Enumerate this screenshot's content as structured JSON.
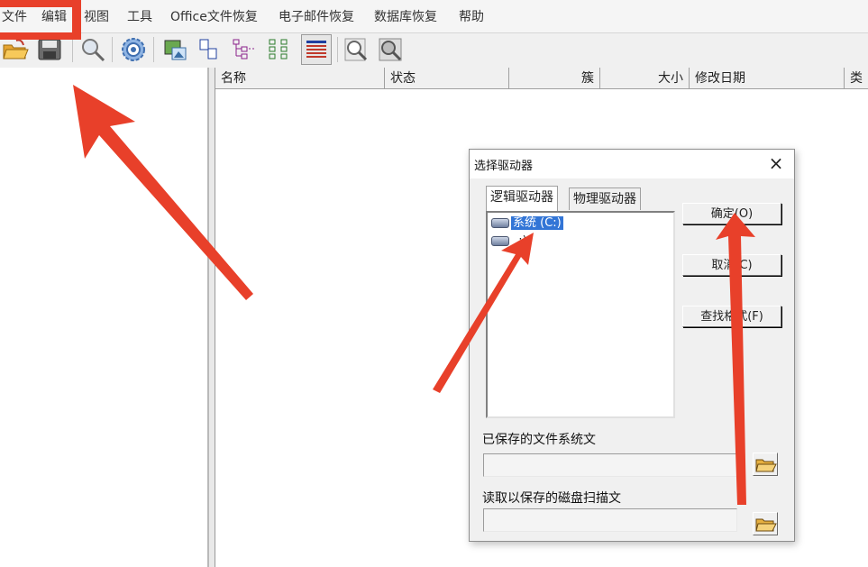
{
  "menubar": {
    "items": [
      {
        "label": "文件"
      },
      {
        "label": "编辑"
      },
      {
        "label": "视图"
      },
      {
        "label": "工具"
      },
      {
        "label": "Office文件恢复"
      },
      {
        "label": "电子邮件恢复"
      },
      {
        "label": "数据库恢复"
      },
      {
        "label": "帮助"
      }
    ]
  },
  "toolbar": {
    "icons": [
      "open-folder-icon",
      "save-icon",
      "search-icon",
      "settings-gear-icon",
      "image-view-icon",
      "file-view-icon",
      "tree-view-icon",
      "list-view-icon",
      "details-view-icon",
      "zoom-preview-icon",
      "preview-icon"
    ]
  },
  "filelist": {
    "columns": [
      "名称",
      "状态",
      "簇",
      "大小",
      "修改日期",
      "类"
    ]
  },
  "dialog": {
    "title": "选择驱动器",
    "close": "×",
    "tabs": [
      "逻辑驱动器",
      "物理驱动器"
    ],
    "drives": [
      {
        "label": "系统 (C:)",
        "selected": true
      },
      {
        "label": "  :)",
        "selected": false
      }
    ],
    "buttons": {
      "ok": "确定(O)",
      "cancel": "取消(C)",
      "find": "查找格式(F)"
    },
    "saved_fs_label": "已保存的文件系统文",
    "saved_fs_value": "",
    "read_scan_label": "读取以保存的磁盘扫描文",
    "read_scan_value": ""
  },
  "annotations": {
    "highlight_color": "#e8402a",
    "arrow_color": "#e8402a"
  }
}
